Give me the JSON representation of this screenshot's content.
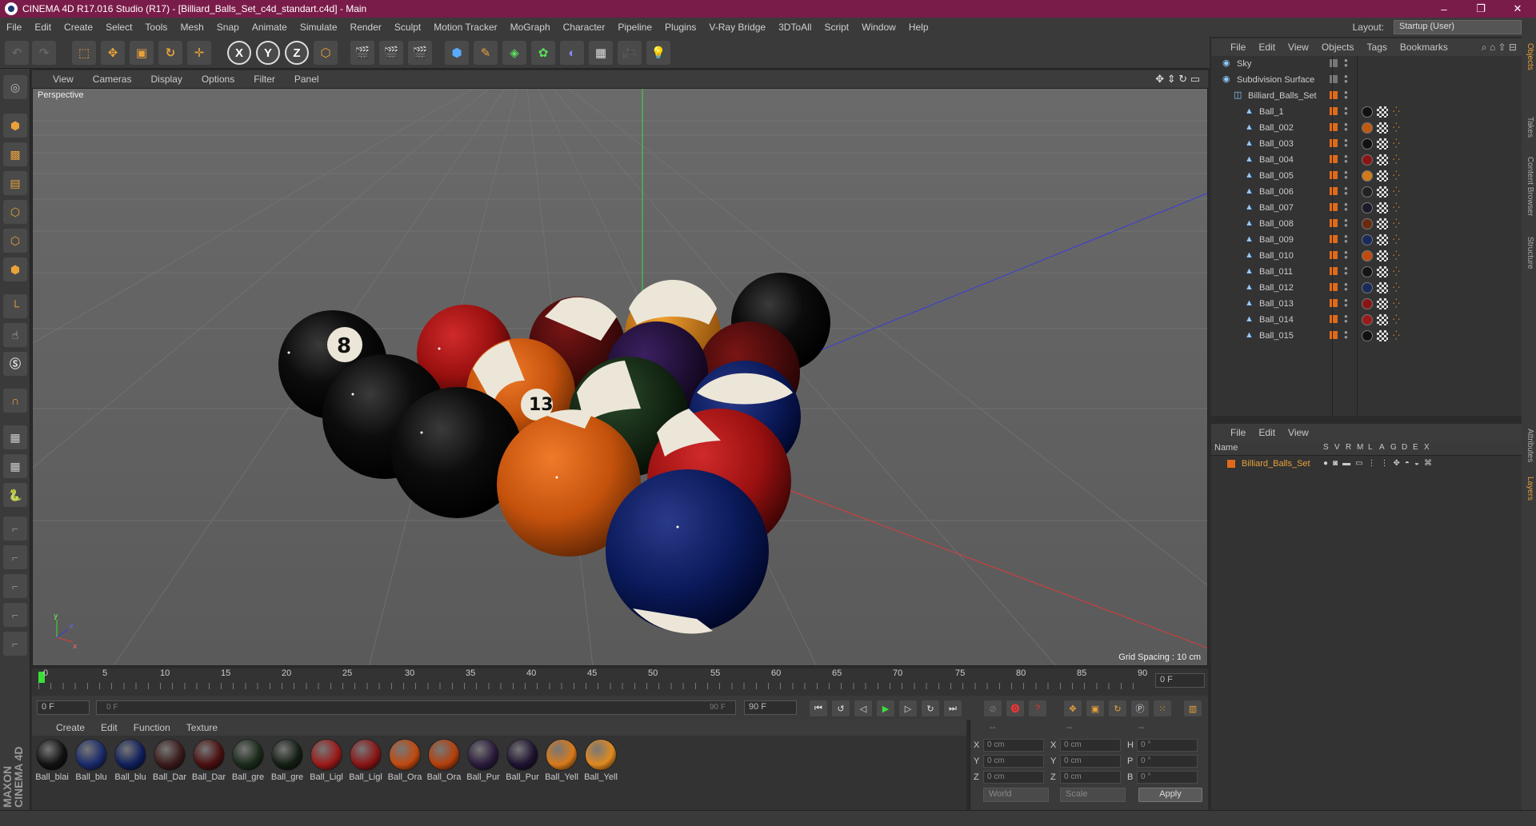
{
  "window": {
    "title": "CINEMA 4D R17.016 Studio (R17) - [Billiard_Balls_Set_c4d_standart.c4d] - Main",
    "controls": [
      "–",
      "❐",
      "✕"
    ]
  },
  "menu": [
    "File",
    "Edit",
    "Create",
    "Select",
    "Tools",
    "Mesh",
    "Snap",
    "Animate",
    "Simulate",
    "Render",
    "Sculpt",
    "Motion Tracker",
    "MoGraph",
    "Character",
    "Pipeline",
    "Plugins",
    "V-Ray Bridge",
    "3DToAll",
    "Script",
    "Window",
    "Help"
  ],
  "layout": {
    "label": "Layout:",
    "value": "Startup (User)"
  },
  "toolbar": {
    "x_axis": "X",
    "y_axis": "Y",
    "z_axis": "Z"
  },
  "viewport": {
    "menu": [
      "View",
      "Cameras",
      "Display",
      "Options",
      "Filter",
      "Panel"
    ],
    "label": "Perspective",
    "grid_spacing": "Grid Spacing : 10 cm",
    "axis_labels": {
      "y": "y",
      "x": "x",
      "z": "z"
    },
    "ball_numbers": {
      "eight": "8",
      "thirteen": "13"
    }
  },
  "timeline": {
    "ticks": [
      "0",
      "5",
      "10",
      "15",
      "20",
      "25",
      "30",
      "35",
      "40",
      "45",
      "50",
      "55",
      "60",
      "65",
      "70",
      "75",
      "80",
      "85",
      "90"
    ],
    "current_frame": "0 F",
    "start_frame": "0 F",
    "range_start": "0 F",
    "range_end": "90 F",
    "end_frame": "90 F"
  },
  "materials": {
    "menu": [
      "Create",
      "Edit",
      "Function",
      "Texture"
    ],
    "items": [
      {
        "label": "Ball_blai",
        "color": "#111111"
      },
      {
        "label": "Ball_blu",
        "color": "#1a2a6a"
      },
      {
        "label": "Ball_blu",
        "color": "#0f1f5a"
      },
      {
        "label": "Ball_Dar",
        "color": "#3a1a1a"
      },
      {
        "label": "Ball_Dar",
        "color": "#4a1010"
      },
      {
        "label": "Ball_gre",
        "color": "#1a2a1a"
      },
      {
        "label": "Ball_gre",
        "color": "#141e14"
      },
      {
        "label": "Ball_Ligl",
        "color": "#9a1a1a"
      },
      {
        "label": "Ball_Ligl",
        "color": "#8a1515"
      },
      {
        "label": "Ball_Ora",
        "color": "#c04a10"
      },
      {
        "label": "Ball_Ora",
        "color": "#b3400c"
      },
      {
        "label": "Ball_Pur",
        "color": "#2a1a3a"
      },
      {
        "label": "Ball_Pur",
        "color": "#1f1230"
      },
      {
        "label": "Ball_Yell",
        "color": "#d87a1a"
      },
      {
        "label": "Ball_Yell",
        "color": "#e08a20"
      }
    ]
  },
  "coords": {
    "header": [
      "--",
      "--",
      "--"
    ],
    "rows": [
      {
        "l1": "X",
        "v1": "0 cm",
        "l2": "X",
        "v2": "0 cm",
        "l3": "H",
        "v3": "0 °"
      },
      {
        "l1": "Y",
        "v1": "0 cm",
        "l2": "Y",
        "v2": "0 cm",
        "l3": "P",
        "v3": "0 °"
      },
      {
        "l1": "Z",
        "v1": "0 cm",
        "l2": "Z",
        "v2": "0 cm",
        "l3": "B",
        "v3": "0 °"
      }
    ],
    "mode": "World",
    "scale": "Scale",
    "apply": "Apply"
  },
  "object_manager": {
    "menu": [
      "File",
      "Edit",
      "View",
      "Objects",
      "Tags",
      "Bookmarks"
    ],
    "objects": [
      {
        "name": "Sky",
        "indent": 0,
        "tagged": false
      },
      {
        "name": "Subdivision Surface",
        "indent": 0,
        "tagged": false
      },
      {
        "name": "Billiard_Balls_Set",
        "indent": 1,
        "tagged": false
      },
      {
        "name": "Ball_1",
        "indent": 2,
        "tagged": true,
        "color": "#111111"
      },
      {
        "name": "Ball_002",
        "indent": 2,
        "tagged": true,
        "color": "#c05a10"
      },
      {
        "name": "Ball_003",
        "indent": 2,
        "tagged": true,
        "color": "#111111"
      },
      {
        "name": "Ball_004",
        "indent": 2,
        "tagged": true,
        "color": "#8a1515"
      },
      {
        "name": "Ball_005",
        "indent": 2,
        "tagged": true,
        "color": "#d07a1a"
      },
      {
        "name": "Ball_006",
        "indent": 2,
        "tagged": true,
        "color": "#222222"
      },
      {
        "name": "Ball_007",
        "indent": 2,
        "tagged": true,
        "color": "#1a1a2a"
      },
      {
        "name": "Ball_008",
        "indent": 2,
        "tagged": true,
        "color": "#6a2a10"
      },
      {
        "name": "Ball_009",
        "indent": 2,
        "tagged": true,
        "color": "#1a2a5a"
      },
      {
        "name": "Ball_010",
        "indent": 2,
        "tagged": true,
        "color": "#c04a10"
      },
      {
        "name": "Ball_011",
        "indent": 2,
        "tagged": true,
        "color": "#151515"
      },
      {
        "name": "Ball_012",
        "indent": 2,
        "tagged": true,
        "color": "#1a2a5a"
      },
      {
        "name": "Ball_013",
        "indent": 2,
        "tagged": true,
        "color": "#8a1515"
      },
      {
        "name": "Ball_014",
        "indent": 2,
        "tagged": true,
        "color": "#9a1a1a"
      },
      {
        "name": "Ball_015",
        "indent": 2,
        "tagged": true,
        "color": "#111111"
      }
    ]
  },
  "layers": {
    "menu": [
      "File",
      "Edit",
      "View"
    ],
    "header": {
      "name": "Name",
      "cols": [
        "S",
        "V",
        "R",
        "M",
        "L",
        "A",
        "G",
        "D",
        "E",
        "X"
      ]
    },
    "items": [
      {
        "name": "Billiard_Balls_Set",
        "color": "#e06a1a"
      }
    ]
  },
  "right_tabs": [
    "Objects",
    "Takes",
    "Content Browser",
    "Structure",
    "Attributes",
    "Layers"
  ],
  "brand": "MAXON CINEMA 4D",
  "colors": {
    "accent": "#7a1c4a",
    "selected_text": "#e8a23a"
  }
}
